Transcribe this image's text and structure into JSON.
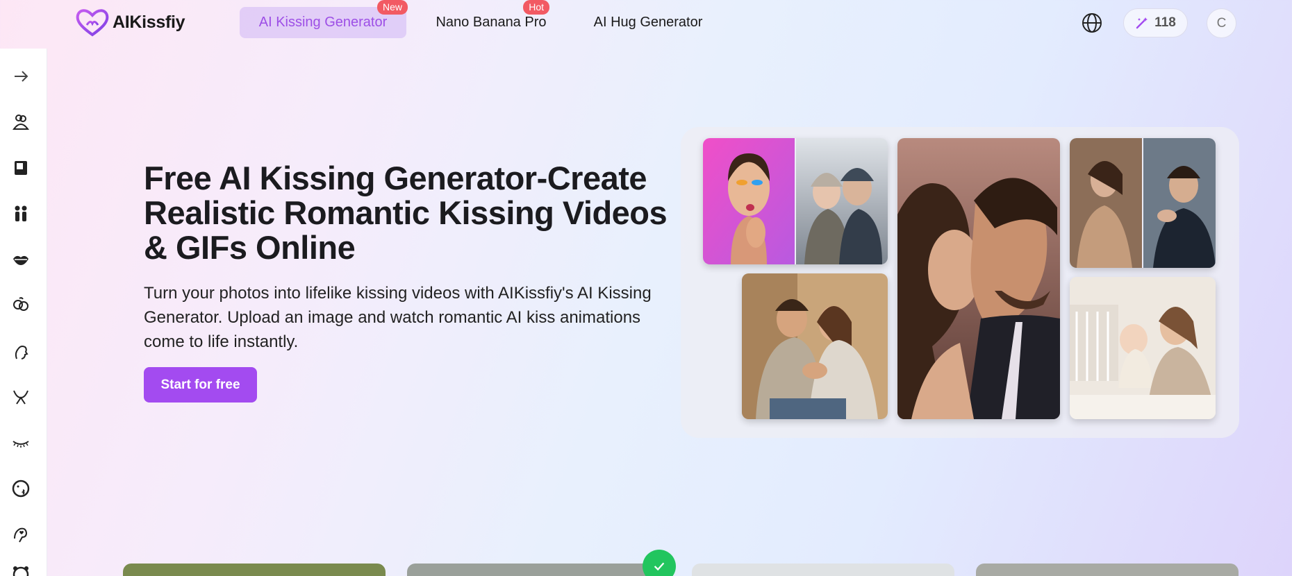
{
  "brand": {
    "name": "AIKissfiy",
    "logo_icon": "heart-logo-icon"
  },
  "nav": {
    "items": [
      {
        "label": "AI Kissing Generator",
        "badge": "New",
        "active": true
      },
      {
        "label": "Nano Banana Pro",
        "badge": "Hot",
        "active": false
      },
      {
        "label": "AI Hug Generator",
        "badge": "",
        "active": false
      }
    ]
  },
  "header": {
    "language_icon": "globe-icon",
    "credits": {
      "icon": "magic-wand-icon",
      "value": "118"
    },
    "avatar_initial": "C"
  },
  "sidebar": {
    "icons": [
      "arrow-right-icon",
      "hug-icon",
      "photo-frame-icon",
      "couple-icon",
      "lips-icon",
      "baby-kiss-icon",
      "face-profile-icon",
      "wings-icon",
      "eyelash-icon",
      "emoji-kiss-icon",
      "hand-heart-icon",
      "bear-icon"
    ]
  },
  "hero": {
    "title": "Free AI Kissing Generator-Create Realistic Romantic Kissing Videos & GIFs Online",
    "description": "Turn your photos into lifelike kissing videos with AIKissfiy's AI Kissing Generator. Upload an image and watch romantic AI kiss animations come to life instantly.",
    "cta_label": "Start for free"
  },
  "collage": {
    "images": [
      "blowing-kiss-woman",
      "winter-couple",
      "couple-kiss-closeup",
      "hand-kiss-couple",
      "cozy-couple-sweaters",
      "mother-baby-kiss"
    ]
  },
  "colors": {
    "accent": "#a34bf0",
    "badge": "#f25a63",
    "nav_active_text": "#9d4fe6",
    "success": "#22c55e"
  }
}
